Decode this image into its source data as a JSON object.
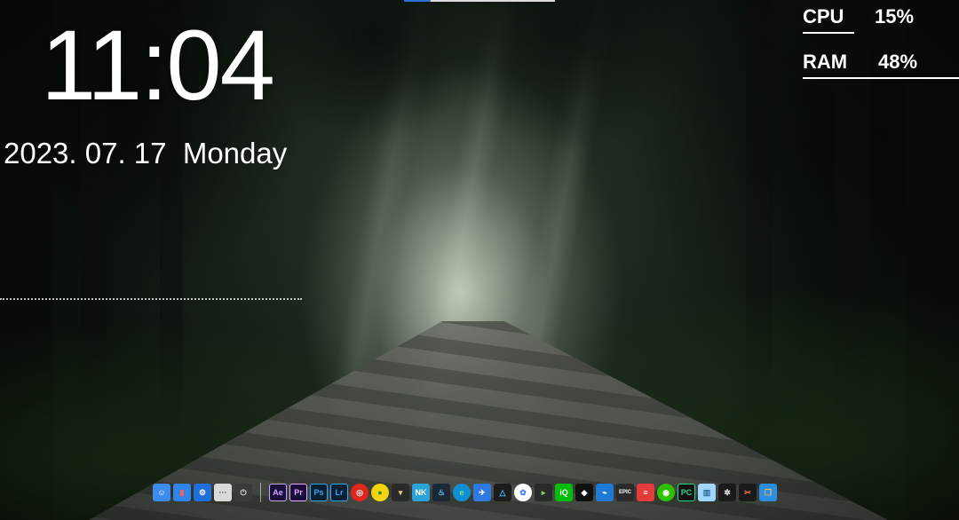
{
  "clock": {
    "time": "11:04",
    "date": "2023. 07. 17  Monday"
  },
  "monitor": {
    "cpu": {
      "label": "CPU",
      "value": "15%"
    },
    "ram": {
      "label": "RAM",
      "value": "48%"
    }
  },
  "dock": {
    "system_items": [
      {
        "name": "finder-icon",
        "glyph": "☺",
        "bg": "#3d8bea",
        "fg": "#ffffff"
      },
      {
        "name": "store-icon",
        "glyph": "▮",
        "bg": "#2f86e8",
        "fg": "#ff5a5a"
      },
      {
        "name": "settings-gear-icon",
        "glyph": "⚙",
        "bg": "#1e6fd9",
        "fg": "#ffffff"
      },
      {
        "name": "more-options-icon",
        "glyph": "···",
        "bg": "#d9d9d9",
        "fg": "#555555"
      },
      {
        "name": "power-icon",
        "glyph": "⏻",
        "bg": "#3a3a3a",
        "fg": "#dddddd"
      }
    ],
    "app_items": [
      {
        "name": "after-effects-icon",
        "glyph": "Ae",
        "bg": "#1a0f3a",
        "fg": "#c7a4ff",
        "style": "square-outline"
      },
      {
        "name": "premiere-pro-icon",
        "glyph": "Pr",
        "bg": "#1a0f3a",
        "fg": "#e9a6ff",
        "style": "square-outline"
      },
      {
        "name": "photoshop-icon",
        "glyph": "Ps",
        "bg": "#0b1f33",
        "fg": "#31a8ff",
        "style": "square-outline"
      },
      {
        "name": "lightroom-icon",
        "glyph": "Lr",
        "bg": "#0b1f33",
        "fg": "#31a8ff",
        "style": "square-outline"
      },
      {
        "name": "netease-music-icon",
        "glyph": "◎",
        "bg": "#e1251b",
        "fg": "#ffffff",
        "style": "circle"
      },
      {
        "name": "yellow-app-icon",
        "glyph": "●",
        "bg": "#f2d30c",
        "fg": "#2a8a3a",
        "style": "circle"
      },
      {
        "name": "winged-logo-icon",
        "glyph": "▾",
        "bg": "#2a2a2a",
        "fg": "#e7d27a"
      },
      {
        "name": "nk-app-icon",
        "glyph": "NK",
        "bg": "#2aa3d8",
        "fg": "#ffffff"
      },
      {
        "name": "steam-icon",
        "glyph": "♨",
        "bg": "#1b2838",
        "fg": "#66c0f4"
      },
      {
        "name": "edge-browser-icon",
        "glyph": "e",
        "bg": "#0f8fd6",
        "fg": "#7fe36e",
        "style": "circle"
      },
      {
        "name": "swallow-app-icon",
        "glyph": "✈",
        "bg": "#2d7be0",
        "fg": "#ffffff"
      },
      {
        "name": "triangle-app-icon",
        "glyph": "△",
        "bg": "#1c1c1c",
        "fg": "#38c2ff"
      },
      {
        "name": "colorful-cloud-icon",
        "glyph": "✿",
        "bg": "#ffffff",
        "fg": "#3b82f6",
        "style": "circle"
      },
      {
        "name": "media-player-icon",
        "glyph": "▸",
        "bg": "#2a2a2a",
        "fg": "#7cd957"
      },
      {
        "name": "iqiyi-icon",
        "glyph": "iQ",
        "bg": "#00be06",
        "fg": "#ffffff"
      },
      {
        "name": "qq-penguin-icon",
        "glyph": "◆",
        "bg": "#111111",
        "fg": "#ffffff"
      },
      {
        "name": "gaming-app-icon",
        "glyph": "⌁",
        "bg": "#1e7ad6",
        "fg": "#ffffff"
      },
      {
        "name": "epic-games-icon",
        "glyph": "EPIC",
        "bg": "#2a2a2a",
        "fg": "#ffffff"
      },
      {
        "name": "red-stripes-app-icon",
        "glyph": "≡",
        "bg": "#e63b3b",
        "fg": "#ffffff"
      },
      {
        "name": "wechat-icon",
        "glyph": "◉",
        "bg": "#2dc100",
        "fg": "#ffffff",
        "style": "circle"
      },
      {
        "name": "pycharm-icon",
        "glyph": "PC",
        "bg": "#111111",
        "fg": "#21d789",
        "style": "square-outline"
      },
      {
        "name": "files-app-icon",
        "glyph": "▥",
        "bg": "#9fd7ff",
        "fg": "#2f6b9e"
      },
      {
        "name": "spiral-app-icon",
        "glyph": "✲",
        "bg": "#1a1a1a",
        "fg": "#ffffff"
      },
      {
        "name": "scissors-app-icon",
        "glyph": "✂",
        "bg": "#1a1a1a",
        "fg": "#ff6a3a"
      },
      {
        "name": "window-app-icon",
        "glyph": "❐",
        "bg": "#2b8ee0",
        "fg": "#ffb84d"
      }
    ]
  }
}
